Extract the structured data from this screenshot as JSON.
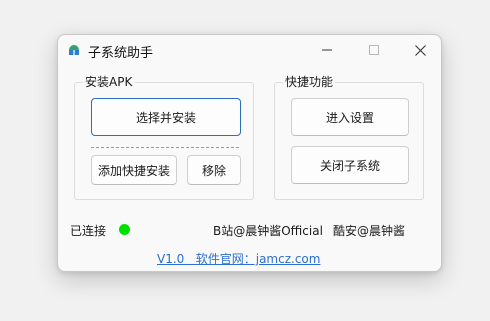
{
  "window": {
    "title": "子系统助手",
    "controls": {
      "minimize_icon": "minimize-icon",
      "maximize_icon": "maximize-icon",
      "close_icon": "close-icon"
    }
  },
  "apk_group": {
    "title": "安装APK",
    "select_install_label": "选择并安装",
    "add_shortcut_label": "添加快捷安装",
    "remove_label": "移除"
  },
  "quick_group": {
    "title": "快捷功能",
    "settings_label": "进入设置",
    "close_subsystem_label": "关闭子系统"
  },
  "status": {
    "label": "已连接",
    "color": "#00e000"
  },
  "credits": {
    "bilibili": "B站@晨钟酱Official",
    "coolapk": "酷安@晨钟酱"
  },
  "footer": {
    "link_text": "V1.0   软件官网：jamcz.com"
  },
  "colors": {
    "accent": "#2a6fb8",
    "link": "#2a6fd0"
  }
}
